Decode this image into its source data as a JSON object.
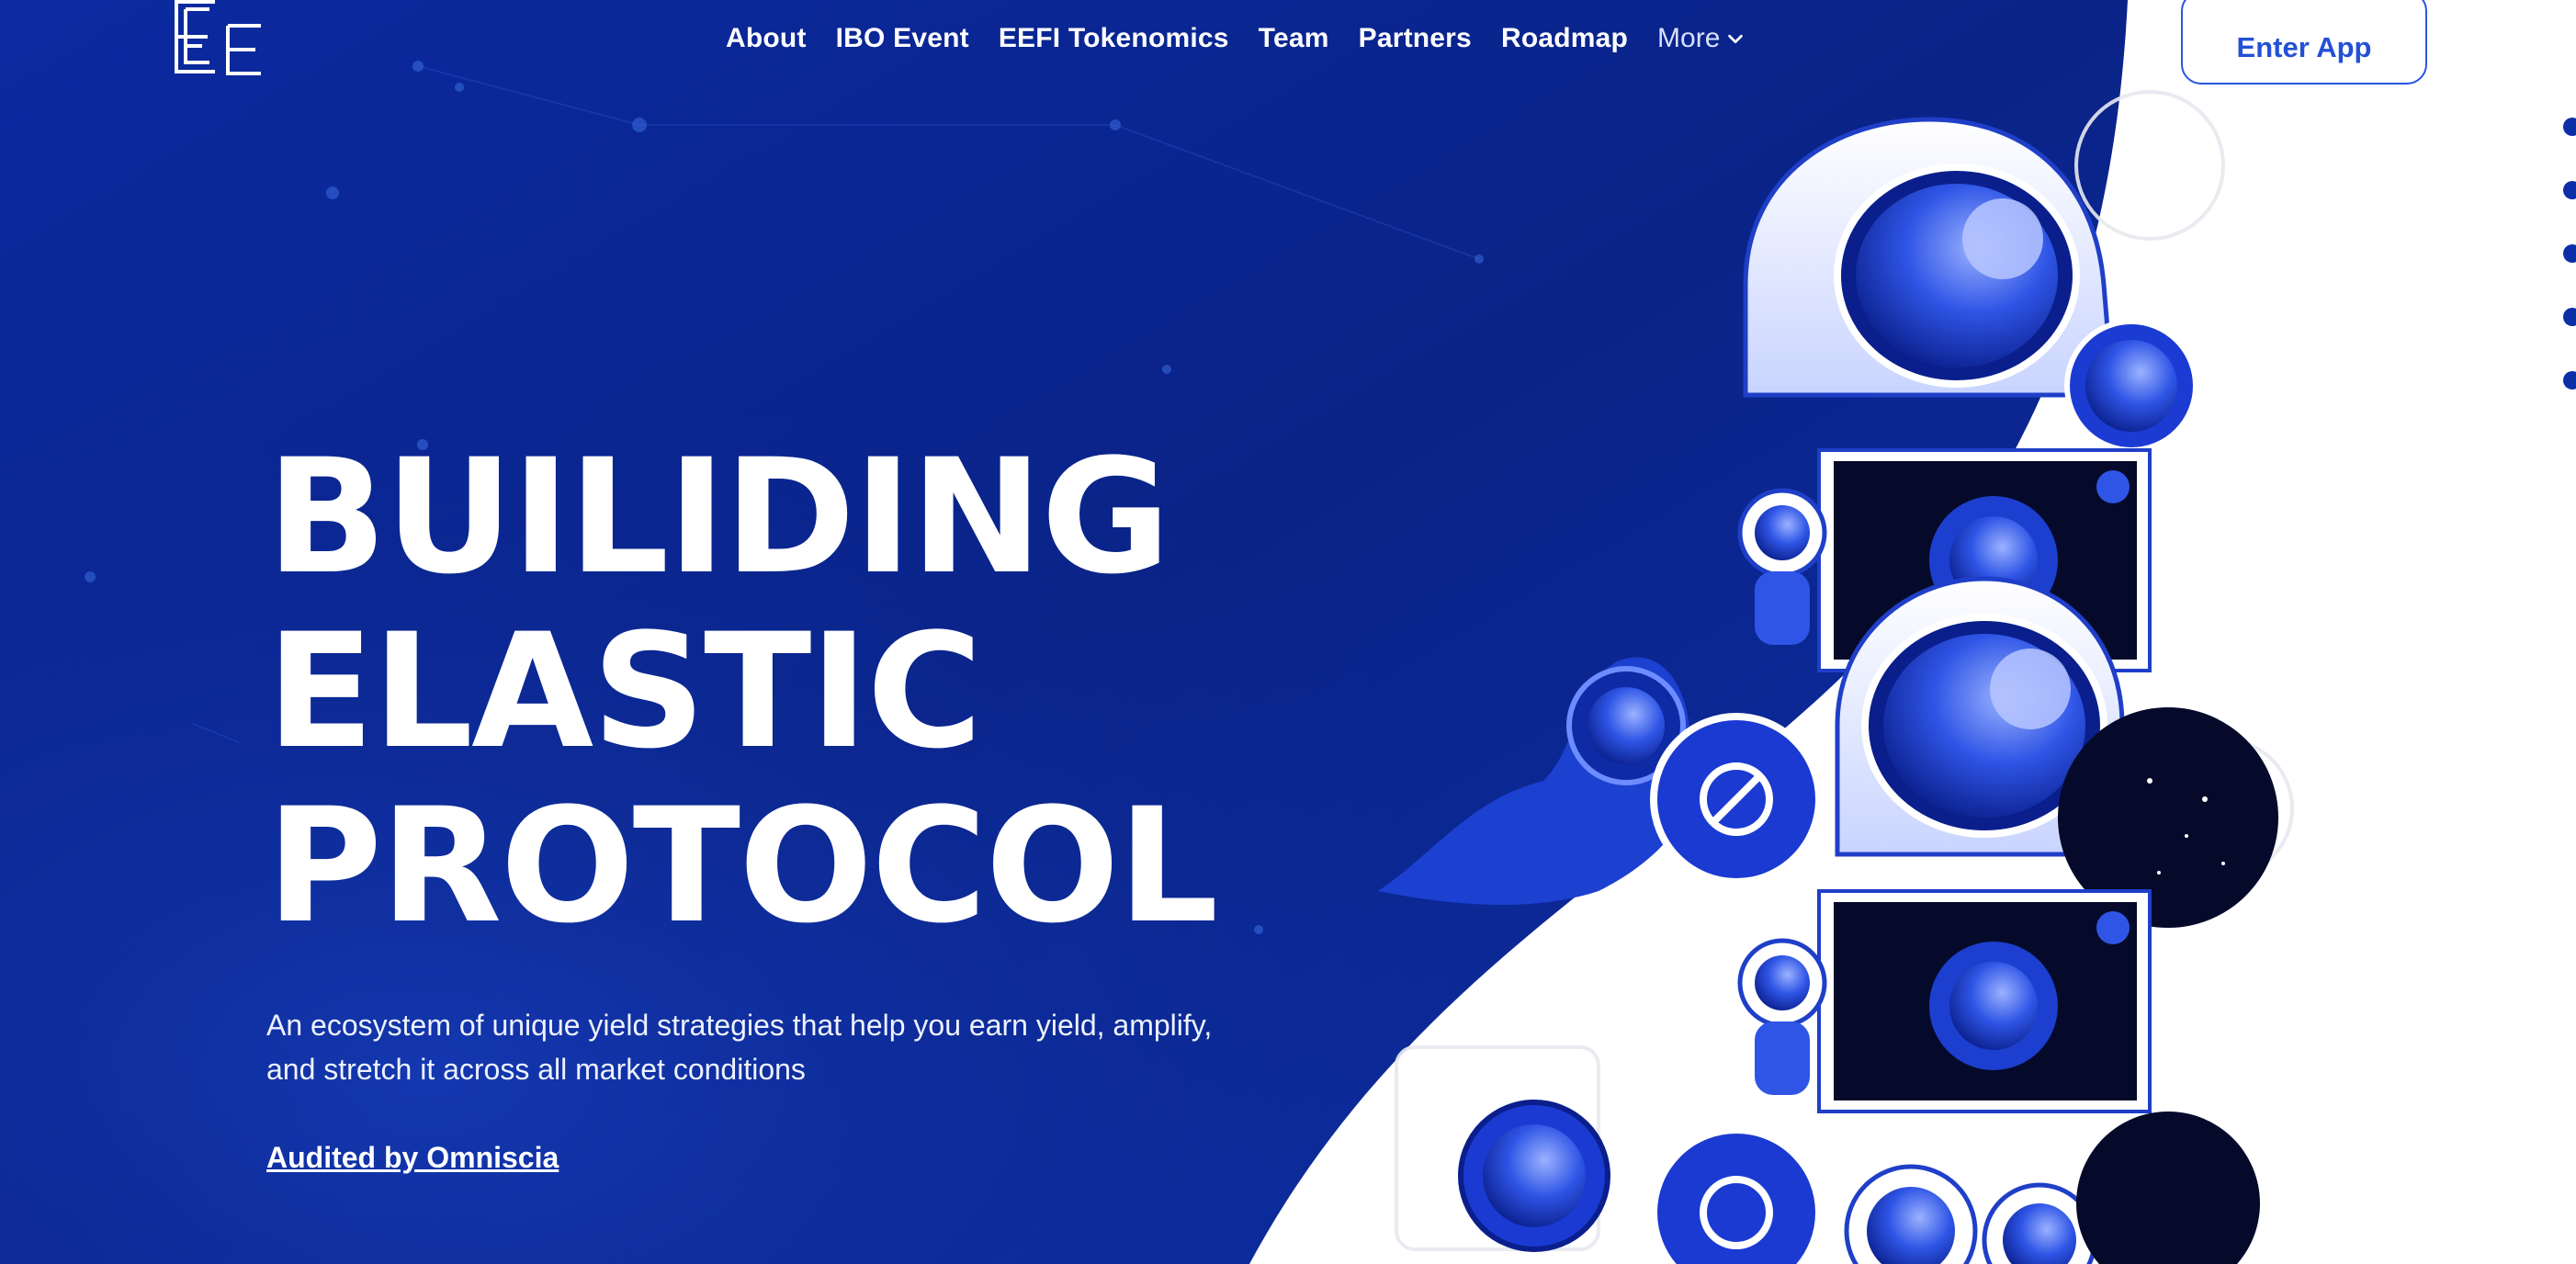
{
  "nav": {
    "items": [
      {
        "label": "About"
      },
      {
        "label": "IBO Event"
      },
      {
        "label": "EEFI Tokenomics"
      },
      {
        "label": "Team"
      },
      {
        "label": "Partners"
      },
      {
        "label": "Roadmap"
      }
    ],
    "more_label": "More"
  },
  "header": {
    "enter_app_label": "Enter App"
  },
  "hero": {
    "title_lines": [
      "BUILIDING",
      "ELASTIC",
      "PROTOCOL"
    ],
    "description": "An ecosystem of unique yield strategies that help you earn yield, amplify, and stretch it across all market conditions",
    "audit_link": "Audited by Omniscia"
  },
  "side_pager": {
    "dot_count": 5
  },
  "theme": {
    "primary_blue": "#0d2ea8",
    "deep_blue": "#0a2280",
    "accent_blue": "#2a56e0",
    "white": "#ffffff"
  },
  "icons": {
    "logo": "ee-logo-icon",
    "more": "chevron-down-icon",
    "illustration": "astronaut-illustration"
  }
}
